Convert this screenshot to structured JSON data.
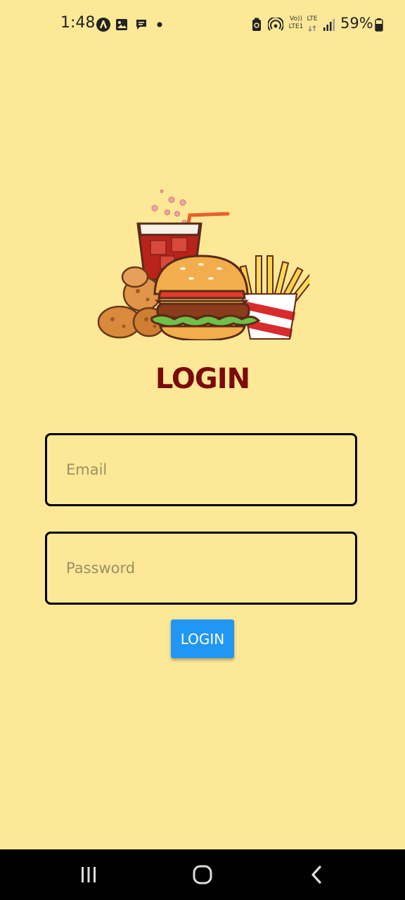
{
  "status_bar": {
    "time": "1:48",
    "volte_label": "Vo))",
    "lte1_label": "LTE1",
    "lte_label": "LTE",
    "battery_percent": "59%",
    "icons": [
      "app-a-icon",
      "image-icon",
      "chat-icon",
      "dot-icon",
      "battery-saver-icon",
      "hotspot-icon",
      "volte-icon",
      "lte-icon",
      "signal-icon",
      "battery-icon"
    ]
  },
  "hero": {
    "illustration": "fast-food-illustration"
  },
  "login": {
    "title": "LOGIN",
    "email_placeholder": "Email",
    "password_placeholder": "Password",
    "button_label": "LOGIN"
  },
  "colors": {
    "background": "#FDE897",
    "title": "#7B0A0A",
    "button": "#2196F3"
  },
  "nav_bar": {
    "icons": [
      "recent-apps-icon",
      "home-icon",
      "back-icon"
    ]
  }
}
